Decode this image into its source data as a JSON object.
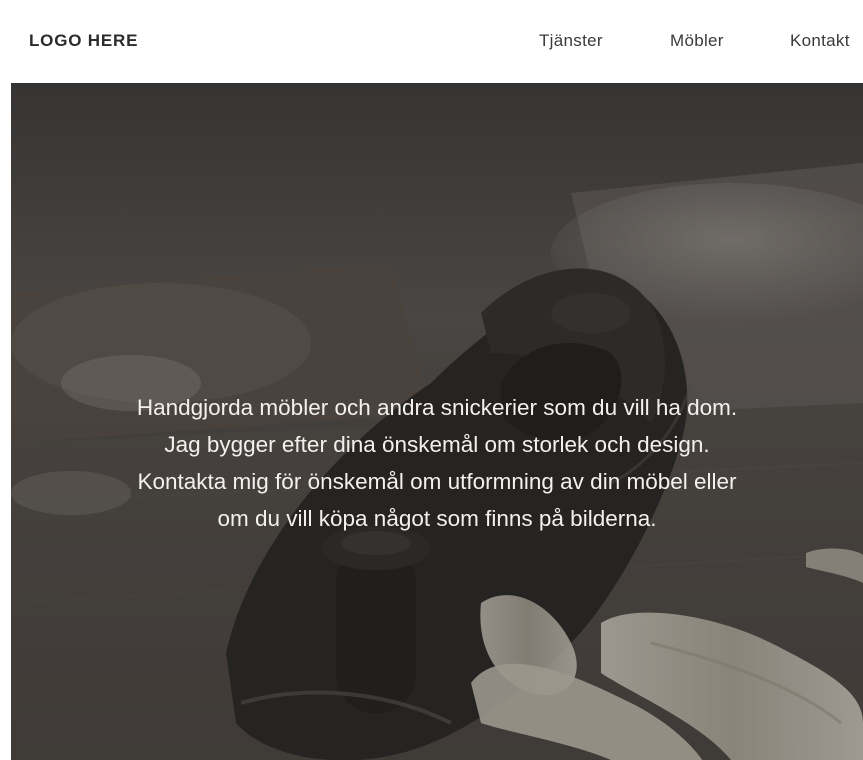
{
  "header": {
    "logo": "LOGO HERE",
    "nav": [
      {
        "label": "Tjänster"
      },
      {
        "label": "Möbler"
      },
      {
        "label": "Kontakt"
      }
    ]
  },
  "hero": {
    "lines": [
      "Handgjorda möbler och andra snickerier som du vill ha dom.",
      "Jag bygger efter dina önskemål om storlek och design.",
      "Kontakta mig för önskemål om utformning av din möbel eller",
      "om du vill köpa något som finns på bilderna."
    ],
    "background_image": "hand-plane-with-wood-shavings",
    "overlay_color": "#2a2724"
  }
}
